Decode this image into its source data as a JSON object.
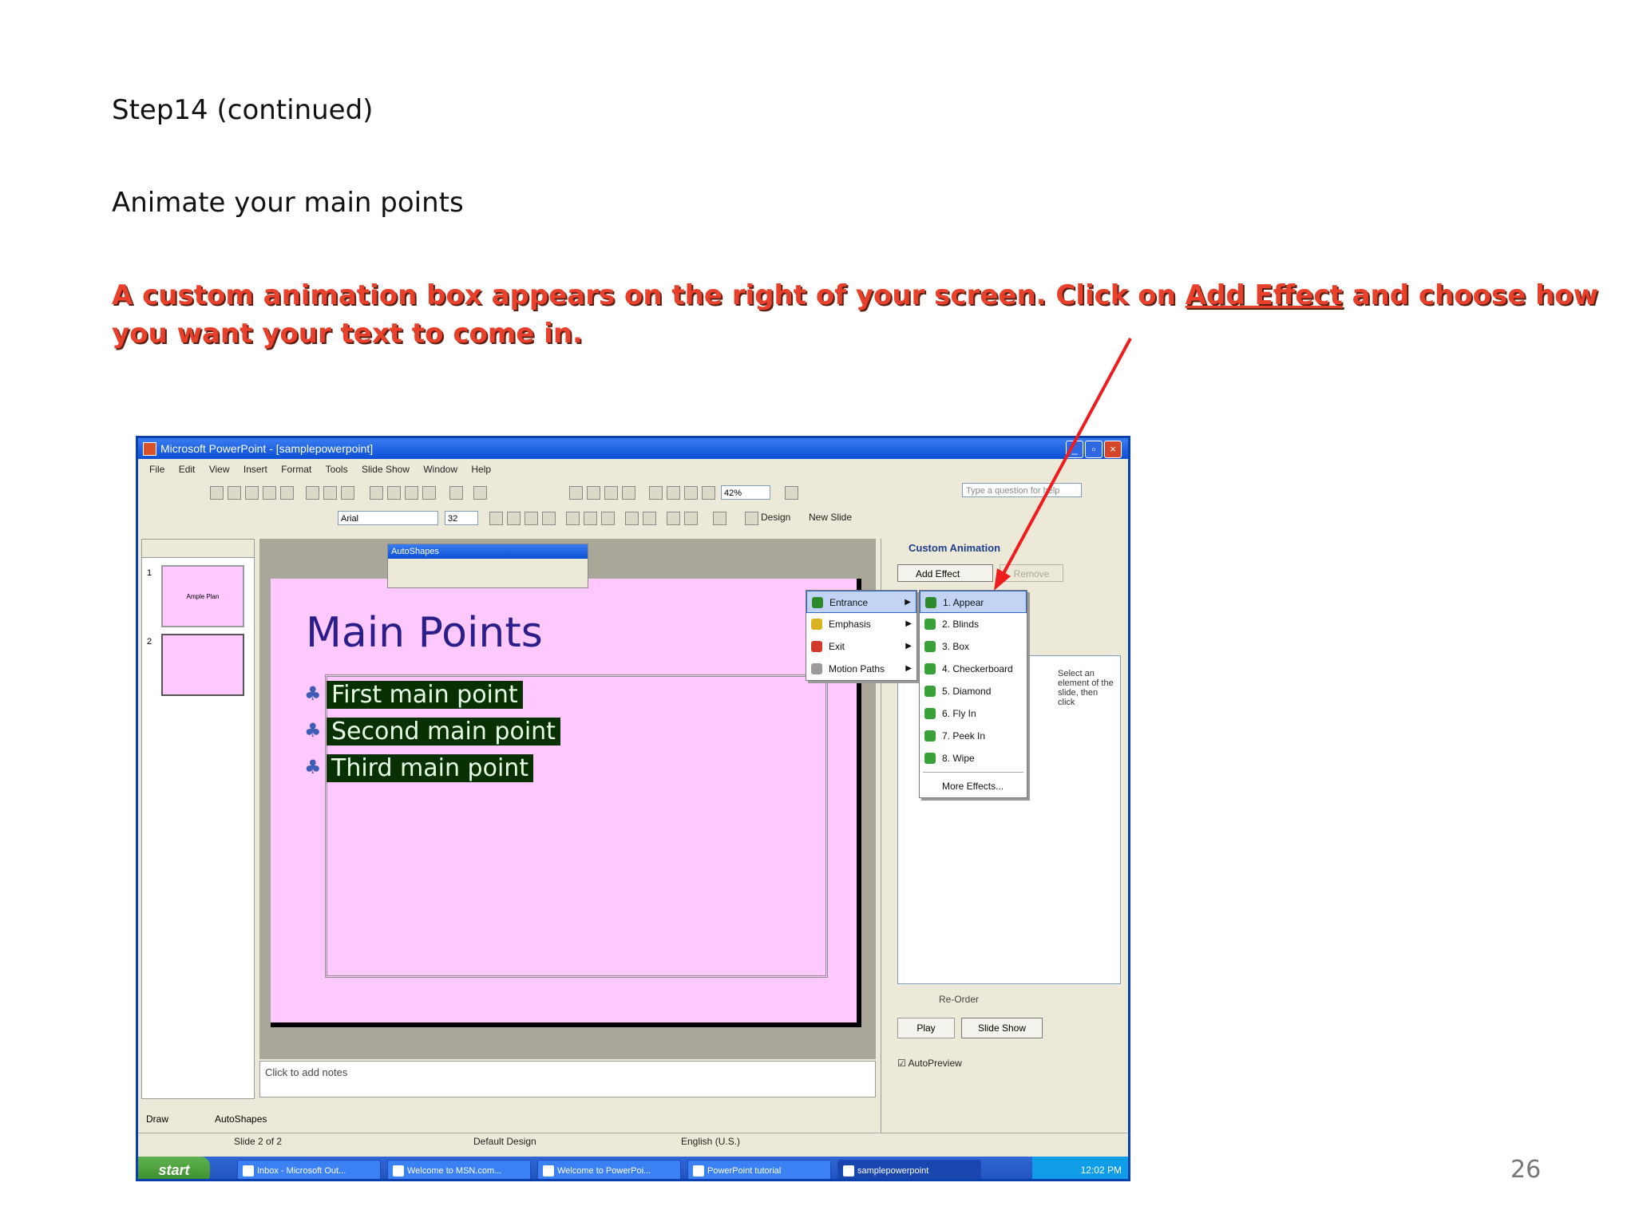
{
  "heading": "Step14 (continued)",
  "subheading": "Animate your main points",
  "instruction": {
    "before_link": "A custom animation box appears on the right of your screen. Click on ",
    "link": "Add Effect",
    "after_link": " and choose how you want your text to come in."
  },
  "page_number": "26",
  "screenshot": {
    "window_title": "Microsoft PowerPoint - [samplepowerpoint]",
    "menu": [
      "File",
      "Edit",
      "View",
      "Insert",
      "Format",
      "Tools",
      "Slide Show",
      "Window",
      "Help"
    ],
    "question_box": "Type a question for help",
    "font_name": "Arial",
    "font_size": "32",
    "zoom": "42%",
    "design_label": "Design",
    "new_slide_label": "New Slide",
    "thumb1_text": "Ample Plan",
    "slide": {
      "title": "Main Points",
      "bullets": [
        "First main point",
        "Second main point",
        "Third main point"
      ]
    },
    "autoshapes_title": "AutoShapes",
    "notes_placeholder": "Click to add notes",
    "task_pane": {
      "title": "Custom Animation",
      "add_effect": "Add Effect",
      "remove": "Remove",
      "hint": "Select an element of the slide, then click",
      "reorder": "Re-Order",
      "play": "Play",
      "slide_show": "Slide Show",
      "autopreview": "AutoPreview"
    },
    "effect_menu": [
      "Entrance",
      "Emphasis",
      "Exit",
      "Motion Paths"
    ],
    "entrance_menu": [
      "1. Appear",
      "2. Blinds",
      "3. Box",
      "4. Checkerboard",
      "5. Diamond",
      "6. Fly In",
      "7. Peek In",
      "8. Wipe",
      "More Effects..."
    ],
    "draw_label": "Draw",
    "autoshapes_draw": "AutoShapes",
    "status": {
      "slide": "Slide 2 of 2",
      "design": "Default Design",
      "language": "English (U.S.)"
    },
    "taskbar": {
      "start": "start",
      "buttons": [
        "Inbox - Microsoft Out...",
        "Welcome to MSN.com...",
        "Welcome to PowerPoi...",
        "PowerPoint tutorial",
        "samplepowerpoint"
      ],
      "clock": "12:02 PM"
    }
  }
}
